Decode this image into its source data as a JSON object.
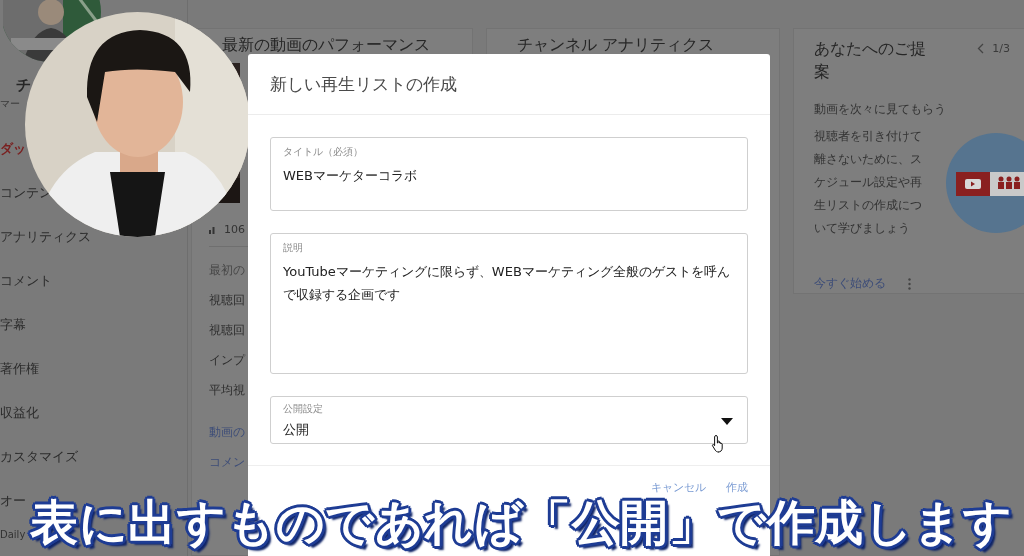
{
  "channel": {
    "name": "チ",
    "subtitle": "マー"
  },
  "sidebar": {
    "items": [
      {
        "label": "ダッ",
        "selected": true
      },
      {
        "label": "コンテン",
        "selected": false
      },
      {
        "label": "アナリティクス",
        "selected": false
      },
      {
        "label": "コメント",
        "selected": false
      },
      {
        "label": "字幕",
        "selected": false
      },
      {
        "label": "著作権",
        "selected": false
      },
      {
        "label": "収益化",
        "selected": false
      },
      {
        "label": "カスタマイズ",
        "selected": false
      },
      {
        "label": "オー",
        "selected": false
      }
    ],
    "footer": "Daily"
  },
  "performance_card": {
    "title": "最新の動画のパフォーマンス",
    "stat": "106",
    "rows": [
      {
        "label": "最初の",
        "kind": "muted"
      },
      {
        "label": "視聴回",
        "kind": "metric"
      },
      {
        "label": "視聴回",
        "kind": "metric"
      },
      {
        "label": "インプ",
        "kind": "metric"
      },
      {
        "label": "平均視",
        "kind": "metric"
      },
      {
        "label": "動画の",
        "kind": "link"
      },
      {
        "label": "コメン",
        "kind": "link"
      }
    ]
  },
  "analytics_card": {
    "title": "チャンネル アナリティクス"
  },
  "suggestion_card": {
    "title": "あなたへのご提案",
    "pager": "1/3",
    "heading": "動画を次々に見てもらう",
    "body": "視聴者を引き付けて離さないために、スケジュール設定や再生リストの作成について学びましょう",
    "action": "今すぐ始める"
  },
  "dialog": {
    "title": "新しい再生リストの作成",
    "fields": [
      {
        "kind": "text",
        "label": "タイトル（必須）",
        "value": "WEBマーケターコラボ"
      },
      {
        "kind": "textarea",
        "label": "説明",
        "value": "YouTubeマーケティングに限らず、WEBマーケティング全般のゲストを呼んで収録する企画です"
      },
      {
        "kind": "select",
        "label": "公開設定",
        "value": "公開"
      }
    ],
    "buttons": [
      {
        "label": "キャンセル"
      },
      {
        "label": "作成"
      }
    ]
  },
  "caption": "表に出すものであれば「公開」で作成します"
}
